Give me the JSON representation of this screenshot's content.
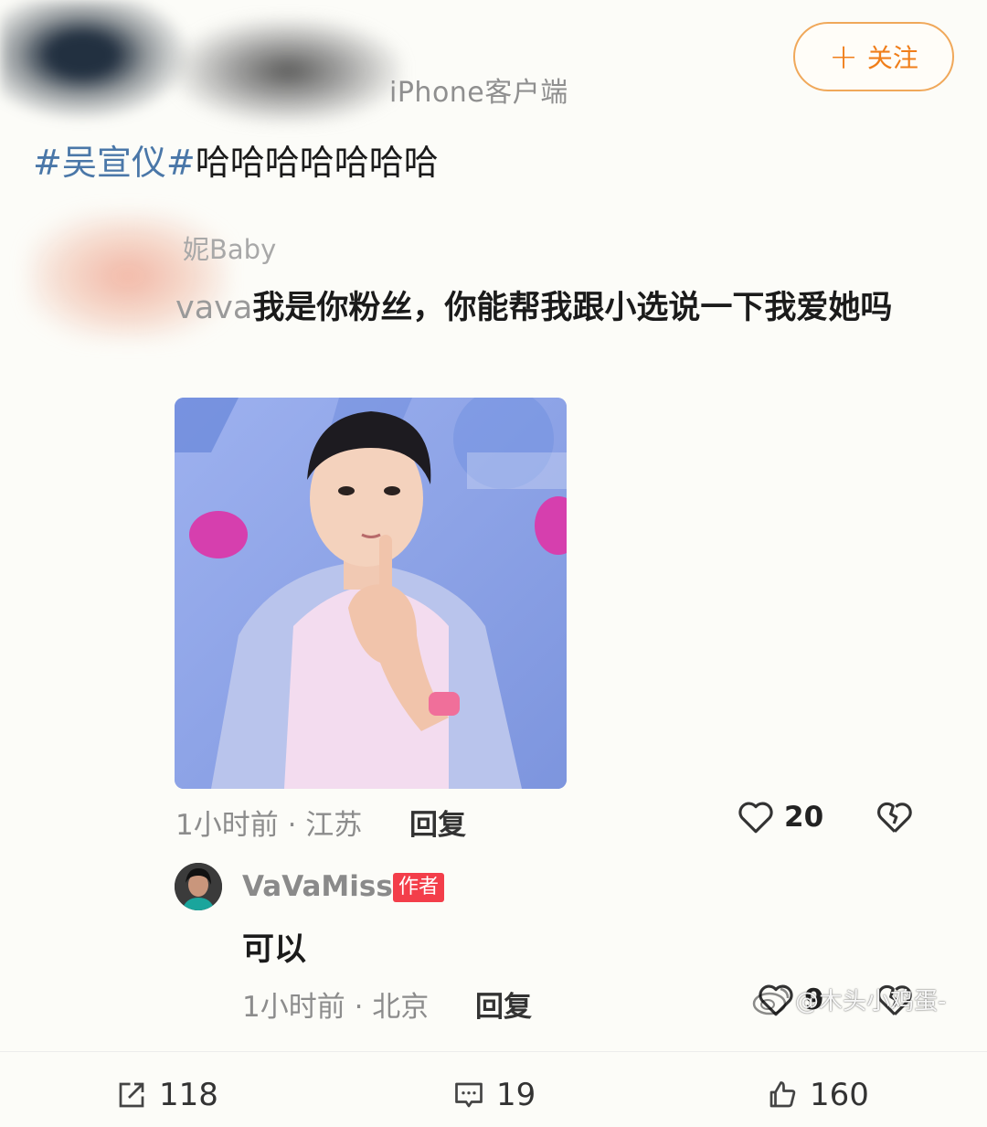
{
  "header": {
    "source": "iPhone客户端",
    "follow_label": "关注",
    "follow_icon": "plus-icon"
  },
  "post": {
    "topic": "#吴宣仪#",
    "text": "哈哈哈哈哈哈哈"
  },
  "comment": {
    "username": "妮Baby",
    "lead": "vava",
    "text": "我是你粉丝，你能帮我跟小选说一下我爱她吗",
    "meta": "1小时前 · 江苏",
    "reply_label": "回复",
    "likes": "20"
  },
  "reply": {
    "username": "VaVaMiss",
    "badge": "作者",
    "text": "可以",
    "meta": "1小时前 · 北京",
    "reply_label": "回复",
    "likes": "9"
  },
  "watermark": "@木头小鸡蛋-",
  "bottom_bar": {
    "share_count": "118",
    "comment_count": "19",
    "like_count": "160"
  },
  "colors": {
    "topic": "#4a77a8",
    "follow": "#f07e1a",
    "badge": "#f33e4a"
  }
}
